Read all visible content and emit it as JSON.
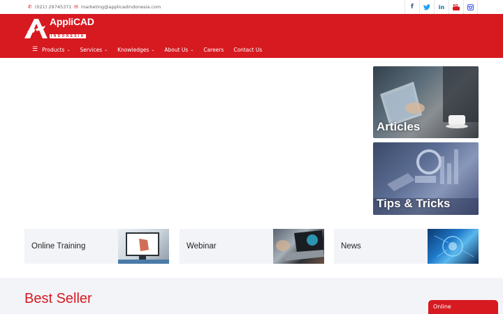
{
  "topbar": {
    "phone": "(021) 29745371",
    "email": "marketing@applicadindonesia.com",
    "socials": [
      "facebook-icon",
      "twitter-icon",
      "linkedin-icon",
      "youtube-icon",
      "instagram-icon"
    ]
  },
  "header": {
    "logo_name": "AppliCAD",
    "logo_sub": "INDONESIA",
    "nav": [
      {
        "label": "Products",
        "has_dropdown": true
      },
      {
        "label": "Services",
        "has_dropdown": true
      },
      {
        "label": "Knowledges",
        "has_dropdown": true
      },
      {
        "label": "About Us",
        "has_dropdown": true
      },
      {
        "label": "Careers",
        "has_dropdown": false
      },
      {
        "label": "Contact Us",
        "has_dropdown": false
      }
    ]
  },
  "promos": {
    "articles": "Articles",
    "tips": "Tips & Tricks"
  },
  "cards": {
    "online_training": "Online Training",
    "webinar": "Webinar",
    "news": "News"
  },
  "bestseller": {
    "title": "Best Seller"
  },
  "chat": {
    "label": "Online"
  },
  "colors": {
    "brand_red": "#d71920",
    "card_bg": "#f3f4f8"
  }
}
